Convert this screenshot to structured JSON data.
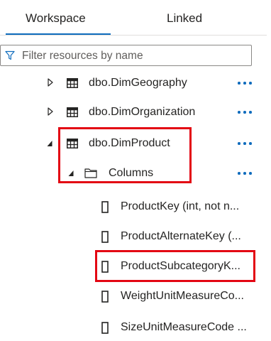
{
  "tabs": [
    {
      "label": "Workspace",
      "active": true
    },
    {
      "label": "Linked",
      "active": false
    }
  ],
  "filter": {
    "placeholder": "Filter resources by name",
    "icon": "funnel-icon"
  },
  "tree": {
    "tables": [
      {
        "label": "dbo.DimGeography",
        "expanded": false,
        "icon": "table-icon"
      },
      {
        "label": "dbo.DimOrganization",
        "expanded": false,
        "icon": "table-icon"
      },
      {
        "label": "dbo.DimProduct",
        "expanded": true,
        "icon": "table-icon"
      }
    ],
    "folder": {
      "label": "Columns",
      "expanded": true,
      "icon": "folder-icon"
    },
    "columns": [
      {
        "label": "ProductKey (int, not n...",
        "icon": "column-icon"
      },
      {
        "label": "ProductAlternateKey (...",
        "icon": "column-icon"
      },
      {
        "label": "ProductSubcategoryK...",
        "icon": "column-icon"
      },
      {
        "label": "WeightUnitMeasureCo...",
        "icon": "column-icon"
      },
      {
        "label": "SizeUnitMeasureCode ...",
        "icon": "column-icon"
      }
    ]
  },
  "colors": {
    "accent": "#0f6cbd",
    "highlight": "#e30613",
    "text": "#252423"
  }
}
